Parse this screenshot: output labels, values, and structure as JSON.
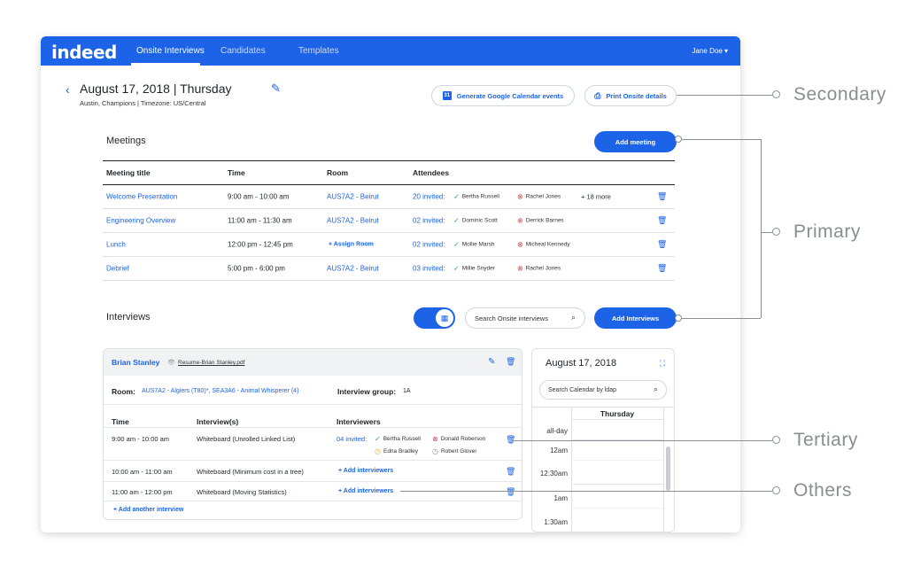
{
  "topbar": {
    "logo": "indeed",
    "tabs": [
      "Onsite Interviews",
      "Candidates",
      "Templates"
    ],
    "user": "Jane Doe ▾"
  },
  "header": {
    "back": "‹",
    "date_title": "August 17, 2018 | Thursday",
    "subtitle": "Austin, Champions | Timezone: US/Central",
    "gcal_button": "Generate Google Calendar events",
    "print_button": "Print Onsite details"
  },
  "meetings": {
    "title": "Meetings",
    "add_button": "Add meeting",
    "columns": [
      "Meeting title",
      "Time",
      "Room",
      "Attendees"
    ],
    "rows": [
      {
        "title": "Welcome Presentation",
        "time": "9:00 am - 10:00 am",
        "room": "AUS7A2 - Beirut",
        "invited": "20 invited:",
        "a1": "Bertha Russell",
        "a2": "Rachel Jones",
        "more": "+ 18 more"
      },
      {
        "title": "Engineering Overview",
        "time": "11:00 am - 11:30 am",
        "room": "AUS7A2 - Beirut",
        "invited": "02 invited:",
        "a1": "Dominic Scott",
        "a2": "Derrick Barnes",
        "more": ""
      },
      {
        "title": "Lunch",
        "time": "12:00 pm - 12:45 pm",
        "room": "+  Assign Room",
        "invited": "02 invited:",
        "a1": "Mollie Marsh",
        "a2": "Micheal Kennedy",
        "more": ""
      },
      {
        "title": "Debrief",
        "time": "5:00 pm - 6:00 pm",
        "room": "AUS7A2 - Beirut",
        "invited": "03 invited:",
        "a1": "Millie Snyder",
        "a2": "Rachel Jones",
        "more": ""
      }
    ]
  },
  "interviews": {
    "title": "Interviews",
    "search_placeholder": "Search Onsite interviews",
    "add_button": "Add Interviews",
    "card": {
      "candidate": "Brian Stanley",
      "resume": "Resume-Brian Stanley.pdf",
      "room_label": "Room:",
      "room_value": "AUS7A2 - Algiers (T80)*, SEA3A6 - Animal Whisperer (4)",
      "group_label": "Interview group:",
      "group_value": "1A",
      "columns": [
        "Time",
        "Interview(s)",
        "Interviewers"
      ],
      "rows": [
        {
          "time": "9:00 am - 10:00 am",
          "interview": "Whiteboard (Unrolled Linked List)",
          "invited": "04 invited:",
          "i1": "Bertha Russell",
          "i2": "Donald Roberson",
          "i3": "Edna Bradley",
          "i4": "Robert Glover"
        },
        {
          "time": "10:00 am - 11:00 am",
          "interview": "Whiteboard  (Minimum cost in a tree)",
          "add": "+  Add interviewers"
        },
        {
          "time": "11:00 am - 12:00 pm",
          "interview": "Whiteboard (Moving Statistics)",
          "add": "+  Add interviewers"
        }
      ],
      "add_another": "+  Add another interview"
    }
  },
  "calendar": {
    "title": "August 17, 2018",
    "search_placeholder": "Search Calendar by ldap",
    "day": "Thursday",
    "times": [
      "all-day",
      "12am",
      "12:30am",
      "1am",
      "1:30am"
    ]
  },
  "annotations": [
    "Secondary",
    "Primary",
    "Tertiary",
    "Others"
  ],
  "colors": {
    "primary": "#1d63e8",
    "success": "#2ca56a",
    "danger": "#d9434a",
    "pending": "#f0a93b",
    "annotation": "#8a8d91"
  }
}
